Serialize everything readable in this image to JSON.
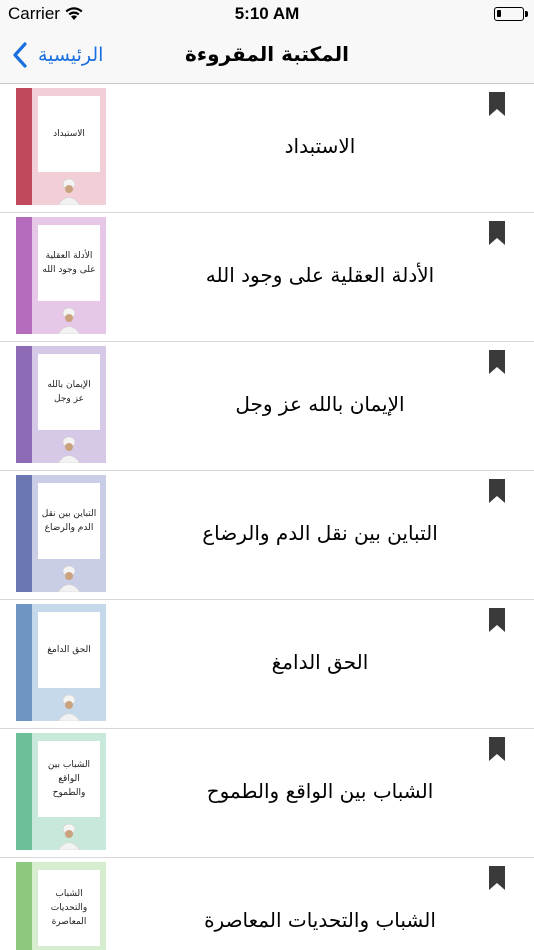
{
  "status_bar": {
    "carrier": "Carrier",
    "time": "5:10 AM"
  },
  "nav": {
    "back_label": "الرئيسية",
    "title": "المكتبة المقروءة"
  },
  "books": [
    {
      "title": "الاستبداد",
      "cover_text": "الاستبداد",
      "spine_color": "#c04a5b",
      "face_color": "#f2cfd6"
    },
    {
      "title": "الأدلة العقلية على وجود الله",
      "cover_text": "الأدلة العقلية على وجود الله",
      "spine_color": "#b56cbc",
      "face_color": "#e6c7e8"
    },
    {
      "title": "الإيمان بالله عز وجل",
      "cover_text": "الإيمان بالله عز وجل",
      "spine_color": "#8e6bb6",
      "face_color": "#d6c8e7"
    },
    {
      "title": "التباين بين نقل الدم والرضاع",
      "cover_text": "التباين بين نقل الدم والرضاع",
      "spine_color": "#6a77b0",
      "face_color": "#c9cde6"
    },
    {
      "title": "الحق الدامغ",
      "cover_text": "الحق الدامغ",
      "spine_color": "#6f96c2",
      "face_color": "#c6d9ea"
    },
    {
      "title": "الشباب بين الواقع والطموح",
      "cover_text": "الشباب بين الواقع والطموح",
      "spine_color": "#6cbf98",
      "face_color": "#c8e9da"
    },
    {
      "title": "الشباب والتحديات المعاصرة",
      "cover_text": "الشباب والتحديات المعاصرة",
      "spine_color": "#8dc87f",
      "face_color": "#d6edcf"
    }
  ]
}
